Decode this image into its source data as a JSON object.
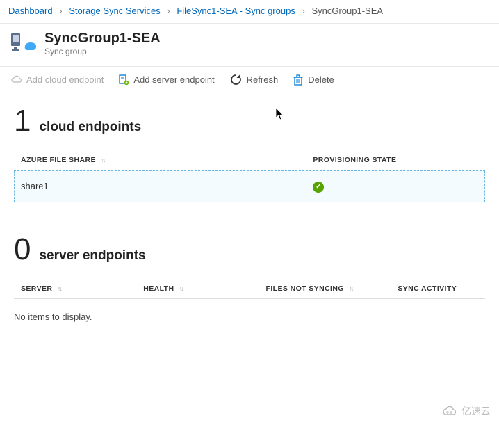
{
  "breadcrumb": {
    "items": [
      "Dashboard",
      "Storage Sync Services",
      "FileSync1-SEA - Sync groups"
    ],
    "current": "SyncGroup1-SEA"
  },
  "header": {
    "title": "SyncGroup1-SEA",
    "subtitle": "Sync group"
  },
  "toolbar": {
    "add_cloud": "Add cloud endpoint",
    "add_server": "Add server endpoint",
    "refresh": "Refresh",
    "delete": "Delete"
  },
  "cloud_section": {
    "count": "1",
    "label": "cloud endpoints",
    "columns": {
      "share": "AZURE FILE SHARE",
      "state": "PROVISIONING STATE"
    },
    "row": {
      "share": "share1",
      "state_icon": "success"
    }
  },
  "server_section": {
    "count": "0",
    "label": "server endpoints",
    "columns": {
      "server": "SERVER",
      "health": "HEALTH",
      "notsync": "FILES NOT SYNCING",
      "activity": "SYNC ACTIVITY"
    },
    "empty": "No items to display."
  },
  "watermark": "亿速云"
}
